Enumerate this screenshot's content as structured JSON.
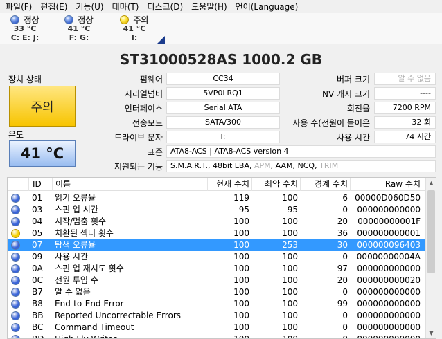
{
  "menu": [
    {
      "label": "파일(F)"
    },
    {
      "label": "편집(E)"
    },
    {
      "label": "기능(U)"
    },
    {
      "label": "테마(T)"
    },
    {
      "label": "디스크(D)"
    },
    {
      "label": "도움말(H)"
    },
    {
      "label": "언어(Language)"
    }
  ],
  "disks": [
    {
      "status": "정상",
      "temp": "33 °C",
      "drives": "C: E: J:",
      "color": "#3a64d8"
    },
    {
      "status": "정상",
      "temp": "41 °C",
      "drives": "F: G:",
      "color": "#3a64d8"
    },
    {
      "status": "주의",
      "temp": "41 °C",
      "drives": "I:",
      "color": "#f5d000"
    }
  ],
  "drive": {
    "title": "ST31000528AS  1000.2 GB",
    "status_label": "장치 상태",
    "health": "주의",
    "temp_label": "온도",
    "temp": "41 °C"
  },
  "fields": {
    "firmware_label": "펌웨어",
    "firmware": "CC34",
    "serial_label": "시리얼넘버",
    "serial": "5VP0LRQ1",
    "interface_label": "인터페이스",
    "interface": "Serial ATA",
    "transfer_label": "전송모드",
    "transfer": "SATA/300",
    "letter_label": "드라이브 문자",
    "letter": "I:",
    "standard_label": "표준",
    "standard": "ATA8-ACS | ATA8-ACS version 4",
    "features_label": "지원되는 기능",
    "features": [
      {
        "text": "S.M.A.R.T.",
        "dim": false
      },
      {
        "text": ", ",
        "dim": false
      },
      {
        "text": "48bit LBA",
        "dim": false
      },
      {
        "text": ", ",
        "dim": false
      },
      {
        "text": "APM",
        "dim": true
      },
      {
        "text": ", ",
        "dim": false
      },
      {
        "text": "AAM",
        "dim": false
      },
      {
        "text": ", ",
        "dim": false
      },
      {
        "text": "NCQ",
        "dim": false
      },
      {
        "text": ", ",
        "dim": false
      },
      {
        "text": "TRIM",
        "dim": true
      }
    ],
    "buffer_label": "버퍼 크기",
    "buffer": "알 수 없음",
    "nvcache_label": "NV 캐시 크기",
    "nvcache": "----",
    "rotation_label": "회전율",
    "rotation": "7200 RPM",
    "powercount_label": "사용 수(전원이 들어온",
    "powercount": "32 회",
    "powerhours_label": "사용 시간",
    "powerhours": "74 시간"
  },
  "table": {
    "headers": {
      "id": "ID",
      "name": "이름",
      "current": "현재 수치",
      "worst": "최악 수치",
      "threshold": "경계 수치",
      "raw": "Raw 수치"
    },
    "rows": [
      {
        "id": "01",
        "name": "읽기 오류율",
        "current": "119",
        "worst": "100",
        "threshold": "6",
        "raw": "00000D060D50",
        "color": "#3a64d8",
        "selected": false
      },
      {
        "id": "03",
        "name": "스핀 업 시간",
        "current": "95",
        "worst": "95",
        "threshold": "0",
        "raw": "000000000000",
        "color": "#3a64d8",
        "selected": false
      },
      {
        "id": "04",
        "name": "시작/멈춤 횟수",
        "current": "100",
        "worst": "100",
        "threshold": "20",
        "raw": "00000000001F",
        "color": "#3a64d8",
        "selected": false
      },
      {
        "id": "05",
        "name": "치환된 섹터 횟수",
        "current": "100",
        "worst": "100",
        "threshold": "36",
        "raw": "000000000001",
        "color": "#f5d000",
        "selected": false
      },
      {
        "id": "07",
        "name": "탐색 오류율",
        "current": "100",
        "worst": "253",
        "threshold": "30",
        "raw": "000000096403",
        "color": "#3a64d8",
        "selected": true
      },
      {
        "id": "09",
        "name": "사용 시간",
        "current": "100",
        "worst": "100",
        "threshold": "0",
        "raw": "00000000004A",
        "color": "#3a64d8",
        "selected": false
      },
      {
        "id": "0A",
        "name": "스핀 업 재시도 횟수",
        "current": "100",
        "worst": "100",
        "threshold": "97",
        "raw": "000000000000",
        "color": "#3a64d8",
        "selected": false
      },
      {
        "id": "0C",
        "name": "전원 투입 수",
        "current": "100",
        "worst": "100",
        "threshold": "20",
        "raw": "000000000020",
        "color": "#3a64d8",
        "selected": false
      },
      {
        "id": "B7",
        "name": "알 수 없음",
        "current": "100",
        "worst": "100",
        "threshold": "0",
        "raw": "000000000000",
        "color": "#3a64d8",
        "selected": false
      },
      {
        "id": "B8",
        "name": "End-to-End Error",
        "current": "100",
        "worst": "100",
        "threshold": "99",
        "raw": "000000000000",
        "color": "#3a64d8",
        "selected": false
      },
      {
        "id": "BB",
        "name": "Reported Uncorrectable Errors",
        "current": "100",
        "worst": "100",
        "threshold": "0",
        "raw": "000000000000",
        "color": "#3a64d8",
        "selected": false
      },
      {
        "id": "BC",
        "name": "Command Timeout",
        "current": "100",
        "worst": "100",
        "threshold": "0",
        "raw": "000000000000",
        "color": "#3a64d8",
        "selected": false
      },
      {
        "id": "BD",
        "name": "High Fly Writes",
        "current": "100",
        "worst": "100",
        "threshold": "0",
        "raw": "000000000000",
        "color": "#3a64d8",
        "selected": false
      }
    ]
  }
}
